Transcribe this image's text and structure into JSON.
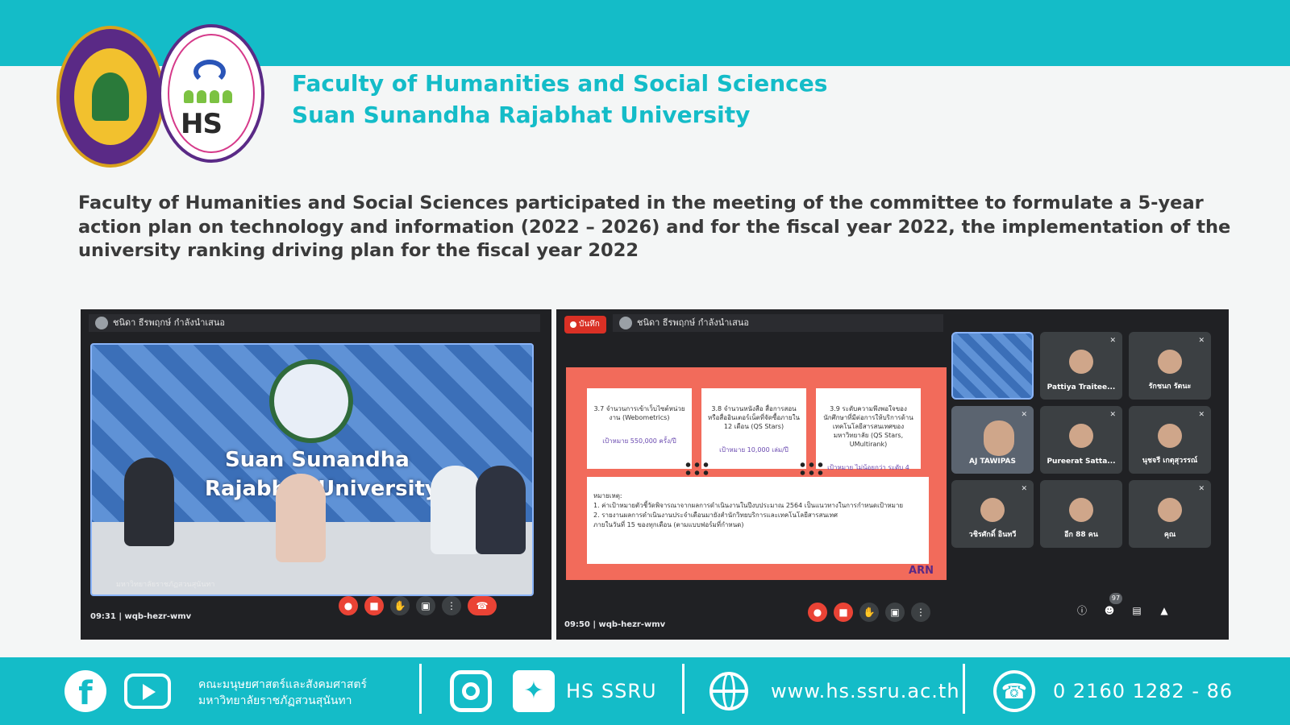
{
  "header": {
    "org_line1": "Faculty of Humanities and Social Sciences",
    "org_line2": "Suan Sunandha Rajabhat University",
    "logo_hs_text": "HS"
  },
  "headline": "Faculty of Humanities and Social Sciences participated in the meeting of the committee to formulate a 5-year action plan on technology and information (2022 – 2026) and for the fiscal year 2022, the implementation of the university ranking driving plan for the fiscal year 2022",
  "meeting_left": {
    "presenter": "ชนิดา ธีรพฤกษ์ กำลังนำเสนอ",
    "watermark_line1": "Suan Sunandha",
    "watermark_line2": "Rajabhat University",
    "video_caption": "มหาวิทยาลัยราชภัฏสวนสุนันทา",
    "time": "09:31",
    "separator": "|",
    "meeting_code": "wqb-hezr-wmv"
  },
  "meeting_right": {
    "record_label": "บันทึก",
    "presenter": "ชนิดา ธีรพฤกษ์ กำลังนำเสนอ",
    "time": "09:50",
    "separator": "|",
    "meeting_code": "wqb-hezr-wmv",
    "participant_count": "97",
    "slide": {
      "box1_title": "3.7 จำนวนการเข้าเว็บไซต์หน่วยงาน (Webometrics)",
      "box1_target": "เป้าหมาย 550,000 ครั้ง/ปี",
      "box2_title": "3.8 จำนวนหนังสือ สื่อการสอน หรือสื่ออินเตอร์เน็ตที่จัดซื้อภายใน 12 เดือน (QS Stars)",
      "box2_target": "เป้าหมาย 10,000 เล่ม/ปี",
      "box3_title": "3.9 ระดับความพึงพอใจของนักศึกษาที่มีต่อการให้บริการด้านเทคโนโลยีสารสนเทศของมหาวิทยาลัย (QS Stars, UMultirank)",
      "box3_target": "เป้าหมาย ไม่น้อยกว่า ระดับ 4",
      "notes_label": "หมายเหตุ:",
      "note1": "1. ค่าเป้าหมายตัวชี้วัดพิจารณาจากผลการดำเนินงานในปีงบประมาณ 2564 เป็นแนวทางในการกำหนดเป้าหมาย",
      "note2": "2. รายงานผลการดำเนินงานประจำเดือนมายังสำนักวิทยบริการและเทคโนโลยีสารสนเทศ",
      "note3": "ภายในวันที่ 15 ของทุกเดือน (ตามแบบฟอร์มที่กำหนด)",
      "arn": "ARN"
    },
    "tiles": [
      {
        "name": ""
      },
      {
        "name": "Pattiya Traitee..."
      },
      {
        "name": "รักชนก รัตนะ"
      },
      {
        "name": "AJ TAWIPAS"
      },
      {
        "name": "Pureerat Satta..."
      },
      {
        "name": "นุชจรี เกตุสุวรรณ์"
      },
      {
        "name": "วชิรศักดิ์ อินทวี"
      },
      {
        "name": "อีก 88 คน"
      },
      {
        "name": "คุณ"
      }
    ]
  },
  "footer": {
    "thai_line1": "คณะมนุษยศาสตร์และสังคมศาสตร์",
    "thai_line2": "มหาวิทยาลัยราชภัฏสวนสุนันทา",
    "social_handle": "HS SSRU",
    "website": "www.hs.ssru.ac.th",
    "phone": "0  2160 1282 - 86"
  },
  "colors": {
    "brand_teal": "#14bcc8",
    "headline_text": "#3a3a3a",
    "meet_bg": "#202124",
    "meet_red": "#ea4335",
    "slide_coral": "#f26b5b"
  },
  "icons": [
    "facebook-icon",
    "youtube-icon",
    "instagram-icon",
    "twitter-icon",
    "globe-icon",
    "phone-icon",
    "mic-off-icon",
    "camera-off-icon",
    "hand-raise-icon",
    "present-icon",
    "more-icon",
    "end-call-icon",
    "info-icon",
    "people-icon",
    "chat-icon",
    "activities-icon"
  ]
}
